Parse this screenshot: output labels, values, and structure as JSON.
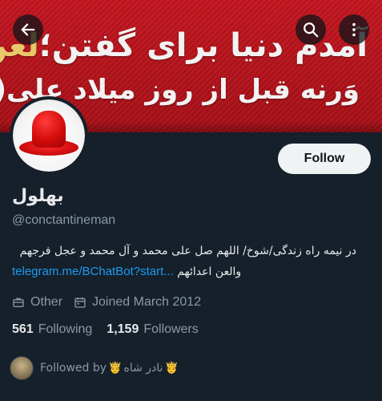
{
  "banner": {
    "line1_prefix": "آمدم دنیا برای گفتن؛",
    "line1_highlight": "لعن عُمَر",
    "line2": "وَرنه قبل از روز میلاد علی(ع) را گفته ام"
  },
  "nav": {
    "back_icon": "arrow-left-icon",
    "search_icon": "search-icon",
    "more_icon": "more-vertical-icon"
  },
  "profile": {
    "display_name": "بهلول",
    "handle": "@conctantineman",
    "bio_line1": "در نیمه راه زندگی/شوخ/ اللهم صل علی محمد و آل محمد و عجل فرجهم",
    "bio_link": "telegram.me/BChatBot?start...",
    "bio_line2_rest": "والعن اعدائهم",
    "category": "Other",
    "joined": "Joined March 2012",
    "following_count": "561",
    "following_label": "Following",
    "followers_count": "1,159",
    "followers_label": "Followers",
    "followed_by_prefix": "Followed by",
    "followed_by_name": "نادر شاه",
    "crown_emoji": "🤴"
  },
  "actions": {
    "follow_label": "Follow"
  },
  "colors": {
    "background": "#15202b",
    "banner_red": "#c4161f",
    "link": "#1d9bf0",
    "secondary_text": "#8b98a5",
    "follow_button_bg": "#eff3f4"
  }
}
